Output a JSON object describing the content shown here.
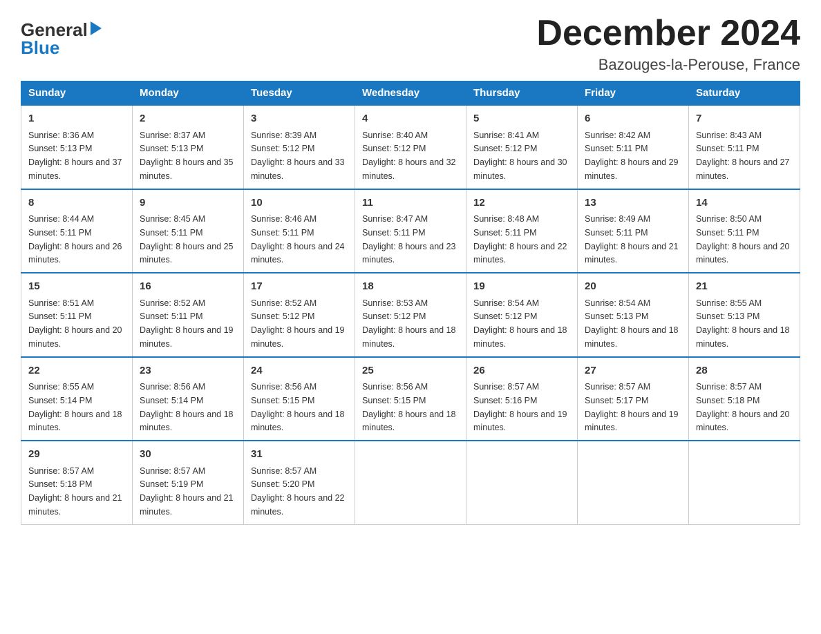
{
  "header": {
    "logo_general": "General",
    "logo_blue": "Blue",
    "month_title": "December 2024",
    "location": "Bazouges-la-Perouse, France"
  },
  "days_of_week": [
    "Sunday",
    "Monday",
    "Tuesday",
    "Wednesday",
    "Thursday",
    "Friday",
    "Saturday"
  ],
  "weeks": [
    [
      {
        "day": "1",
        "sunrise": "8:36 AM",
        "sunset": "5:13 PM",
        "daylight": "8 hours and 37 minutes."
      },
      {
        "day": "2",
        "sunrise": "8:37 AM",
        "sunset": "5:13 PM",
        "daylight": "8 hours and 35 minutes."
      },
      {
        "day": "3",
        "sunrise": "8:39 AM",
        "sunset": "5:12 PM",
        "daylight": "8 hours and 33 minutes."
      },
      {
        "day": "4",
        "sunrise": "8:40 AM",
        "sunset": "5:12 PM",
        "daylight": "8 hours and 32 minutes."
      },
      {
        "day": "5",
        "sunrise": "8:41 AM",
        "sunset": "5:12 PM",
        "daylight": "8 hours and 30 minutes."
      },
      {
        "day": "6",
        "sunrise": "8:42 AM",
        "sunset": "5:11 PM",
        "daylight": "8 hours and 29 minutes."
      },
      {
        "day": "7",
        "sunrise": "8:43 AM",
        "sunset": "5:11 PM",
        "daylight": "8 hours and 27 minutes."
      }
    ],
    [
      {
        "day": "8",
        "sunrise": "8:44 AM",
        "sunset": "5:11 PM",
        "daylight": "8 hours and 26 minutes."
      },
      {
        "day": "9",
        "sunrise": "8:45 AM",
        "sunset": "5:11 PM",
        "daylight": "8 hours and 25 minutes."
      },
      {
        "day": "10",
        "sunrise": "8:46 AM",
        "sunset": "5:11 PM",
        "daylight": "8 hours and 24 minutes."
      },
      {
        "day": "11",
        "sunrise": "8:47 AM",
        "sunset": "5:11 PM",
        "daylight": "8 hours and 23 minutes."
      },
      {
        "day": "12",
        "sunrise": "8:48 AM",
        "sunset": "5:11 PM",
        "daylight": "8 hours and 22 minutes."
      },
      {
        "day": "13",
        "sunrise": "8:49 AM",
        "sunset": "5:11 PM",
        "daylight": "8 hours and 21 minutes."
      },
      {
        "day": "14",
        "sunrise": "8:50 AM",
        "sunset": "5:11 PM",
        "daylight": "8 hours and 20 minutes."
      }
    ],
    [
      {
        "day": "15",
        "sunrise": "8:51 AM",
        "sunset": "5:11 PM",
        "daylight": "8 hours and 20 minutes."
      },
      {
        "day": "16",
        "sunrise": "8:52 AM",
        "sunset": "5:11 PM",
        "daylight": "8 hours and 19 minutes."
      },
      {
        "day": "17",
        "sunrise": "8:52 AM",
        "sunset": "5:12 PM",
        "daylight": "8 hours and 19 minutes."
      },
      {
        "day": "18",
        "sunrise": "8:53 AM",
        "sunset": "5:12 PM",
        "daylight": "8 hours and 18 minutes."
      },
      {
        "day": "19",
        "sunrise": "8:54 AM",
        "sunset": "5:12 PM",
        "daylight": "8 hours and 18 minutes."
      },
      {
        "day": "20",
        "sunrise": "8:54 AM",
        "sunset": "5:13 PM",
        "daylight": "8 hours and 18 minutes."
      },
      {
        "day": "21",
        "sunrise": "8:55 AM",
        "sunset": "5:13 PM",
        "daylight": "8 hours and 18 minutes."
      }
    ],
    [
      {
        "day": "22",
        "sunrise": "8:55 AM",
        "sunset": "5:14 PM",
        "daylight": "8 hours and 18 minutes."
      },
      {
        "day": "23",
        "sunrise": "8:56 AM",
        "sunset": "5:14 PM",
        "daylight": "8 hours and 18 minutes."
      },
      {
        "day": "24",
        "sunrise": "8:56 AM",
        "sunset": "5:15 PM",
        "daylight": "8 hours and 18 minutes."
      },
      {
        "day": "25",
        "sunrise": "8:56 AM",
        "sunset": "5:15 PM",
        "daylight": "8 hours and 18 minutes."
      },
      {
        "day": "26",
        "sunrise": "8:57 AM",
        "sunset": "5:16 PM",
        "daylight": "8 hours and 19 minutes."
      },
      {
        "day": "27",
        "sunrise": "8:57 AM",
        "sunset": "5:17 PM",
        "daylight": "8 hours and 19 minutes."
      },
      {
        "day": "28",
        "sunrise": "8:57 AM",
        "sunset": "5:18 PM",
        "daylight": "8 hours and 20 minutes."
      }
    ],
    [
      {
        "day": "29",
        "sunrise": "8:57 AM",
        "sunset": "5:18 PM",
        "daylight": "8 hours and 21 minutes."
      },
      {
        "day": "30",
        "sunrise": "8:57 AM",
        "sunset": "5:19 PM",
        "daylight": "8 hours and 21 minutes."
      },
      {
        "day": "31",
        "sunrise": "8:57 AM",
        "sunset": "5:20 PM",
        "daylight": "8 hours and 22 minutes."
      },
      null,
      null,
      null,
      null
    ]
  ]
}
